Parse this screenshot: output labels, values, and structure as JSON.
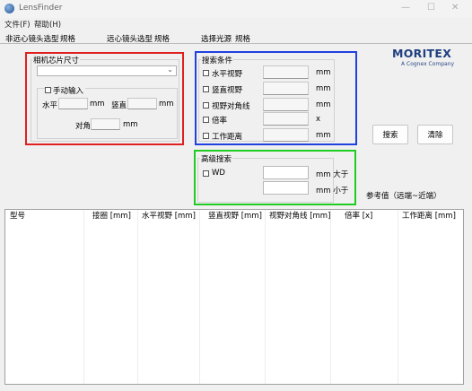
{
  "window": {
    "title": "LensFinder",
    "minimize_glyph": "—",
    "maximize_glyph": "☐",
    "close_glyph": "✕"
  },
  "menu": [
    {
      "label": "文件(F)"
    },
    {
      "label": "帮助(H)"
    }
  ],
  "tabs": [
    {
      "label": "非远心镜头选型"
    },
    {
      "label": "规格"
    },
    {
      "label": "远心镜头选型"
    },
    {
      "label": "规格"
    },
    {
      "label": "选择光源"
    },
    {
      "label": "规格"
    }
  ],
  "sensor": {
    "group_label": "相机芯片尺寸",
    "dropdown_value": "",
    "manual_label": "手动输入",
    "horizontal_label": "水平",
    "horizontal_value": "",
    "vertical_label": "竖直",
    "vertical_value": "",
    "diagonal_label": "对角",
    "diagonal_value": "",
    "unit": "mm",
    "manual_checked": false
  },
  "search": {
    "group_label": "搜索条件",
    "rows": [
      {
        "label": "水平视野",
        "value": "",
        "unit": "mm",
        "checked": false
      },
      {
        "label": "竖直视野",
        "value": "",
        "unit": "mm",
        "checked": false
      },
      {
        "label": "视野对角线",
        "value": "",
        "unit": "mm",
        "checked": false
      },
      {
        "label": "倍率",
        "value": "",
        "unit": "x",
        "checked": false
      },
      {
        "label": "工作距离",
        "value": "",
        "unit": "mm",
        "checked": false
      }
    ]
  },
  "advanced": {
    "group_label": "高级搜索",
    "wd_label": "WD",
    "wd_checked": false,
    "min_value": "",
    "max_value": "",
    "greater_label": "mm 大于",
    "less_label": "mm 小于"
  },
  "buttons": {
    "search": "搜索",
    "clear": "清除"
  },
  "reference_label": "参考值（远端~近端）",
  "logo": {
    "name": "MORITEX",
    "subtitle": "A Cognex Company"
  },
  "table": {
    "columns": [
      "型号",
      "接圈 [mm]",
      "水平视野 [mm]",
      "竖直视野 [mm]",
      "视野对角线 [mm]",
      "倍率 [x]",
      "工作距离 [mm]"
    ],
    "rows": []
  }
}
